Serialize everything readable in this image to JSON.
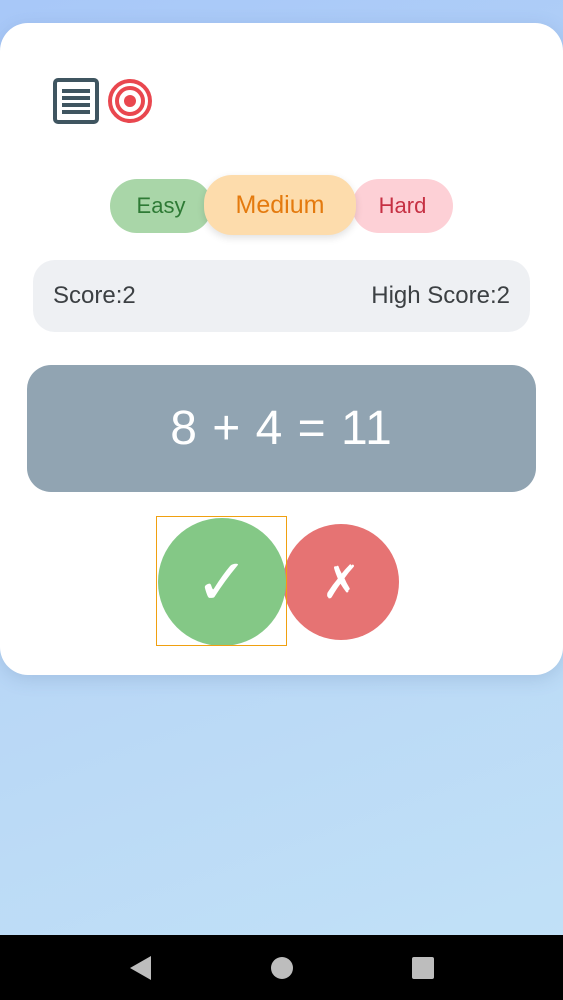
{
  "toolbar": {
    "icons": [
      "list-icon",
      "target-icon"
    ]
  },
  "difficulty": {
    "easy": "Easy",
    "medium": "Medium",
    "hard": "Hard",
    "selected": "Medium"
  },
  "scores": {
    "score_label": "Score:2",
    "high_score_label": "High Score:2"
  },
  "question": {
    "equation": "8 + 4 = 11"
  },
  "answers": {
    "correct_symbol": "✓",
    "wrong_symbol": "✗"
  },
  "colors": {
    "easy_bg": "#a9d6a8",
    "medium_bg": "#fddcac",
    "hard_bg": "#fdd0d6",
    "equation_bg": "#91a4b2",
    "correct_bg": "#84c886",
    "wrong_bg": "#e67373"
  },
  "system_nav": {
    "icons": [
      "back-icon",
      "home-icon",
      "recents-icon"
    ]
  }
}
